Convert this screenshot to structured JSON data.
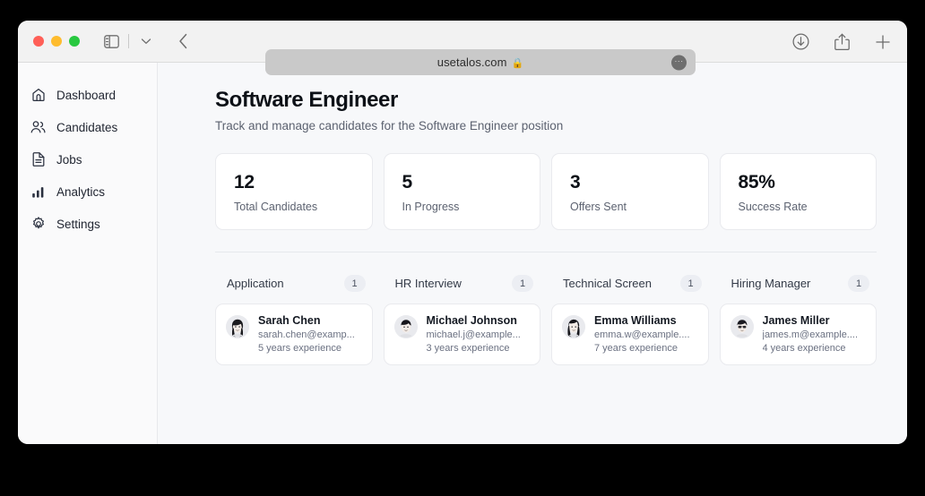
{
  "browser": {
    "traffic_lights": [
      "close",
      "minimize",
      "maximize"
    ],
    "sidebar_toggle_icon": "sidebar-toggle-icon",
    "tab_overview_icon": "chevron-down-icon",
    "back_icon": "chevron-left-icon",
    "address": "usetalos.com",
    "address_lock_icon": "lock-icon",
    "address_more_icon": "ellipsis-icon",
    "downloads_icon": "download-icon",
    "share_icon": "share-icon",
    "new_tab_icon": "plus-icon"
  },
  "sidebar": {
    "items": [
      {
        "label": "Dashboard",
        "icon": "home-icon"
      },
      {
        "label": "Candidates",
        "icon": "users-icon"
      },
      {
        "label": "Jobs",
        "icon": "document-icon"
      },
      {
        "label": "Analytics",
        "icon": "bar-chart-icon"
      },
      {
        "label": "Settings",
        "icon": "gear-icon"
      }
    ]
  },
  "page": {
    "title": "Software Engineer",
    "subtitle": "Track and manage candidates for the Software Engineer position"
  },
  "stats": [
    {
      "value": "12",
      "label": "Total Candidates"
    },
    {
      "value": "5",
      "label": "In Progress"
    },
    {
      "value": "3",
      "label": "Offers Sent"
    },
    {
      "value": "85%",
      "label": "Success Rate"
    }
  ],
  "board": {
    "columns": [
      {
        "title": "Application",
        "count": "1",
        "candidates": [
          {
            "name": "Sarah Chen",
            "email": "sarah.chen@examp...",
            "experience": "5 years experience",
            "avatar": "avatar-photo"
          }
        ]
      },
      {
        "title": "HR Interview",
        "count": "1",
        "candidates": [
          {
            "name": "Michael Johnson",
            "email": "michael.j@example...",
            "experience": "3 years experience",
            "avatar": "avatar-photo"
          }
        ]
      },
      {
        "title": "Technical Screen",
        "count": "1",
        "candidates": [
          {
            "name": "Emma Williams",
            "email": "emma.w@example....",
            "experience": "7 years experience",
            "avatar": "avatar-photo"
          }
        ]
      },
      {
        "title": "Hiring Manager",
        "count": "1",
        "candidates": [
          {
            "name": "James Miller",
            "email": "james.m@example....",
            "experience": "4 years experience",
            "avatar": "avatar-photo"
          }
        ]
      }
    ]
  },
  "colors": {
    "desktop": "#000000",
    "toolbar": "#f2f2f2",
    "sidebar": "#fafafb",
    "main": "#f7f8fa",
    "card": "#ffffff",
    "border": "#e9eaee",
    "text_primary": "#0d1117",
    "text_muted": "#5c6270"
  }
}
